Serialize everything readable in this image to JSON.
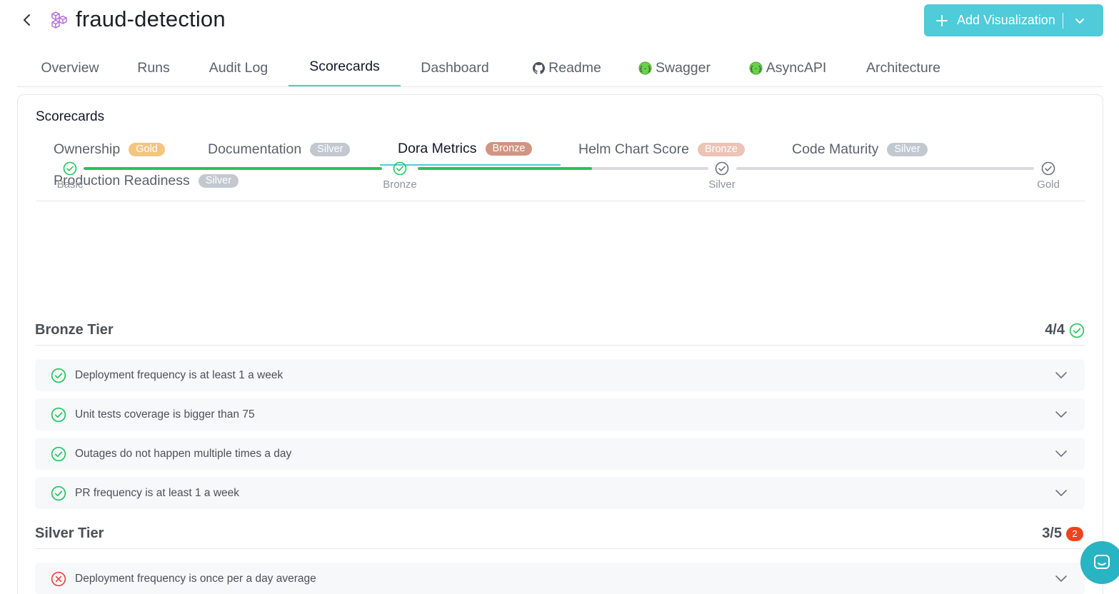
{
  "header": {
    "title": "fraud-detection",
    "add_visualization_label": "Add Visualization",
    "back_icon": "chevron-left-icon",
    "entity_icon": "cubes-icon",
    "accent": "#4fcbd9"
  },
  "tabs": [
    {
      "label": "Overview",
      "icon": null,
      "active": false
    },
    {
      "label": "Runs",
      "icon": null,
      "active": false
    },
    {
      "label": "Audit Log",
      "icon": null,
      "active": false
    },
    {
      "label": "Scorecards",
      "icon": null,
      "active": true
    },
    {
      "label": "Dashboard",
      "icon": null,
      "active": false
    },
    {
      "label": "Readme",
      "icon": "github-icon",
      "active": false
    },
    {
      "label": "Swagger",
      "icon": "swagger-icon",
      "active": false
    },
    {
      "label": "AsyncAPI",
      "icon": "asyncapi-icon",
      "active": false
    },
    {
      "label": "Architecture",
      "icon": null,
      "active": false
    }
  ],
  "scorecards": {
    "title": "Scorecards",
    "tabs": [
      {
        "label": "Ownership",
        "badge": "Gold",
        "badge_color": "#f3c57e",
        "active": false
      },
      {
        "label": "Documentation",
        "badge": "Silver",
        "badge_color": "#c3c8d0",
        "active": false
      },
      {
        "label": "Dora Metrics",
        "badge": "Bronze",
        "badge_color": "#d09583",
        "active": true
      },
      {
        "label": "Helm Chart Score",
        "badge": "Bronze",
        "badge_color": "#edc3b5",
        "active": false
      },
      {
        "label": "Code Maturity",
        "badge": "Silver",
        "badge_color": "#c3c8d0",
        "active": false
      },
      {
        "label": "Production Readiness",
        "badge": "Silver",
        "badge_color": "#c3c8d0",
        "active": false
      }
    ]
  },
  "progress": {
    "levels": [
      {
        "label": "Basic",
        "achieved": true
      },
      {
        "label": "Bronze",
        "achieved": true
      },
      {
        "label": "Silver",
        "achieved": false
      },
      {
        "label": "Gold",
        "achieved": false
      }
    ],
    "segment_fill": [
      1.0,
      0.6,
      0.0
    ]
  },
  "tiers": [
    {
      "name": "Bronze Tier",
      "score": "4/4",
      "status": "complete",
      "rules": [
        {
          "text": "Deployment frequency is at least 1 a week",
          "passed": true
        },
        {
          "text": "Unit tests coverage is bigger than 75",
          "passed": true
        },
        {
          "text": "Outages do not happen multiple times a day",
          "passed": true
        },
        {
          "text": "PR frequency is at least 1 a week",
          "passed": true
        }
      ]
    },
    {
      "name": "Silver Tier",
      "score": "3/5",
      "failed_count": "2",
      "status": "incomplete",
      "rules": [
        {
          "text": "Deployment frequency is once per a day average",
          "passed": false
        }
      ]
    }
  ],
  "colors": {
    "pass": "#22c55e",
    "fail": "#ef4444",
    "pending": "#6b7280"
  },
  "chat": {
    "icon": "chat-icon"
  }
}
